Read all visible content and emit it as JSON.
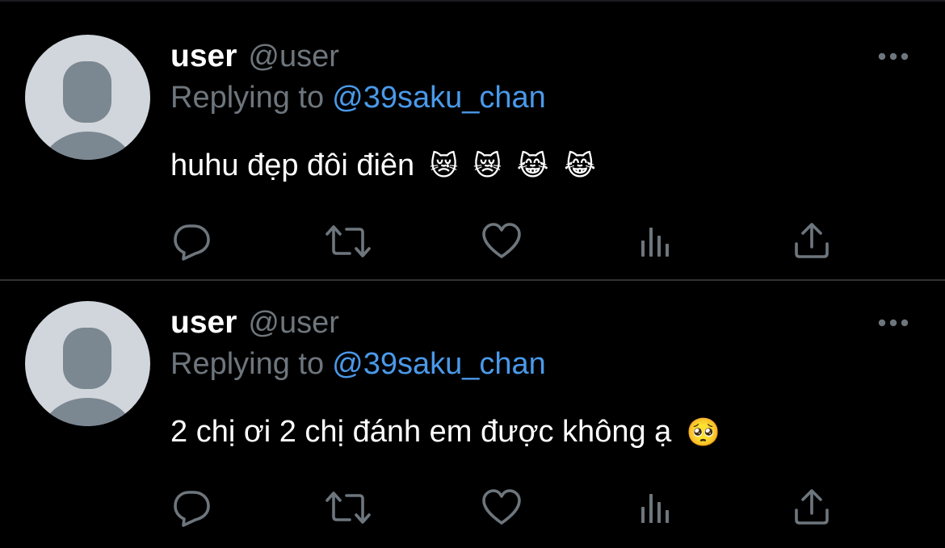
{
  "tweets": [
    {
      "display_name": "user",
      "handle": "@user",
      "replying_prefix": "Replying to",
      "replying_handle": "@39saku_chan",
      "text": "huhu đẹp đôi điên",
      "emojis": [
        "😿",
        "😿",
        "😹",
        "😹"
      ]
    },
    {
      "display_name": "user",
      "handle": "@user",
      "replying_prefix": "Replying to",
      "replying_handle": "@39saku_chan",
      "text": "2 chị ơi 2 chị đánh em được không ạ",
      "emojis": [
        "🥺"
      ]
    }
  ],
  "icons": {
    "more": "more-horizontal-icon",
    "reply": "reply-bubble-icon",
    "retweet": "retweet-icon",
    "like": "heart-icon",
    "views": "views-bar-chart-icon",
    "share": "share-upload-icon"
  },
  "colors": {
    "background": "#000000",
    "text": "#ffffff",
    "secondary": "#6e767d",
    "mention": "#4a99e9",
    "avatar_bg": "#d0d6db",
    "avatar_fg": "#7b8791",
    "divider": "#2f3336"
  }
}
